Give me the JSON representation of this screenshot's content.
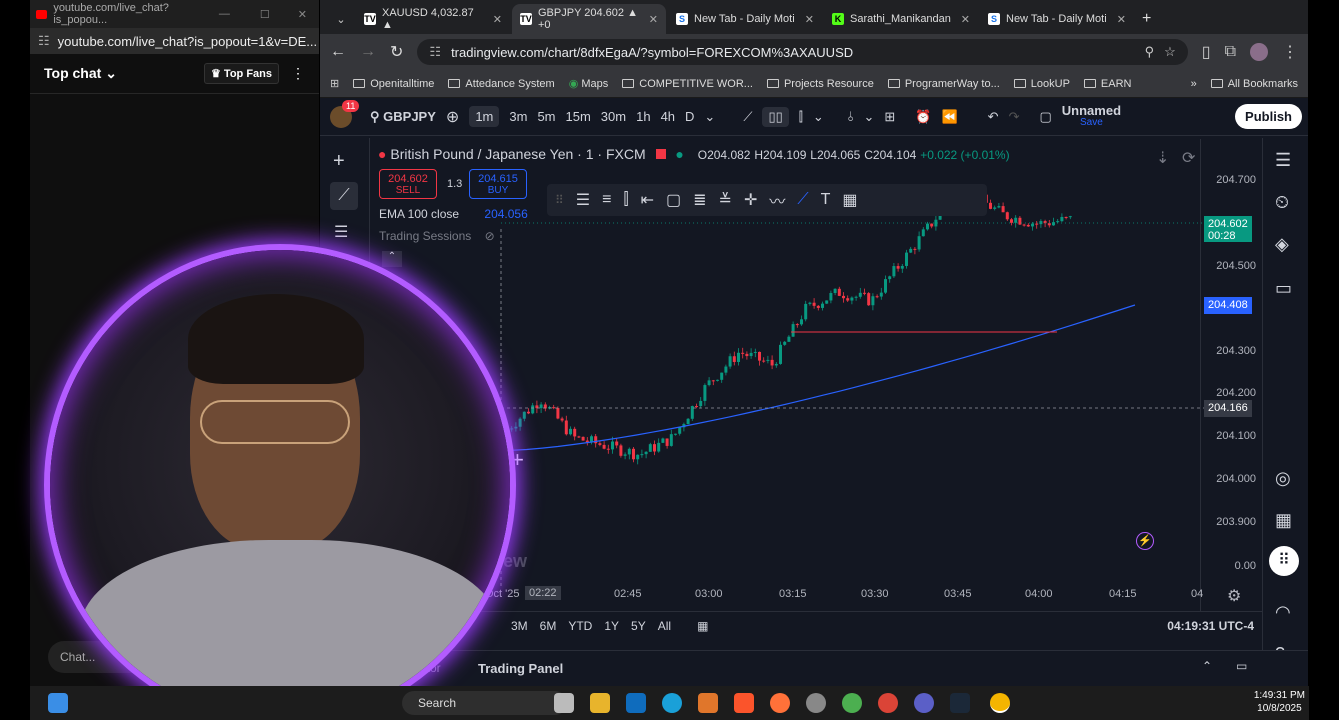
{
  "youtube": {
    "window_title": "youtube.com/live_chat?is_popou...",
    "url": "youtube.com/live_chat?is_popout=1&v=DE...",
    "top_chat": "Top chat",
    "top_fans": "Top Fans",
    "chat_placeholder": "Chat..."
  },
  "browser": {
    "tabs": [
      {
        "label": "XAUUSD 4,032.87 ▲",
        "active": false
      },
      {
        "label": "GBPJPY 204.602 ▲ +0",
        "active": true
      },
      {
        "label": "New Tab - Daily Moti",
        "active": false
      },
      {
        "label": "Sarathi_Manikandan",
        "active": false
      },
      {
        "label": "New Tab - Daily Moti",
        "active": false
      }
    ],
    "url": "tradingview.com/chart/8dfxEgaA/?symbol=FOREXCOM%3AXAUUSD",
    "bookmarks": [
      "Openitalltime",
      "Attedance System",
      "Maps",
      "COMPETITIVE WOR...",
      "Projects Resource",
      "ProgramerWay to...",
      "LookUP",
      "EARN"
    ],
    "all_bookmarks": "All Bookmarks"
  },
  "tv": {
    "notification_count": "11",
    "symbol": "GBPJPY",
    "intervals": [
      "1m",
      "3m",
      "5m",
      "15m",
      "30m",
      "1h",
      "4h",
      "D"
    ],
    "selected_interval": "1m",
    "layout_name": "Unnamed",
    "layout_status": "Save",
    "publish": "Publish",
    "legend_title": "British Pound / Japanese Yen · 1 · FXCM",
    "ohlc": {
      "o": "O204.082",
      "h": "H204.109",
      "l": "L204.065",
      "c": "C204.104",
      "chg": "+0.022 (+0.01%)"
    },
    "sell_price": "204.602",
    "sell_label": "SELL",
    "spread": "1.3",
    "buy_price": "204.615",
    "buy_label": "BUY",
    "ema_label": "EMA 100 close",
    "ema_value": "204.056",
    "sessions_label": "Trading Sessions",
    "price_label": "204.602",
    "countdown": "00:28",
    "ema_price_label": "204.408",
    "crosshair_price": "204.166",
    "watermark": "view",
    "y_ticks": [
      "204.700",
      "204.500",
      "204.300",
      "204.200",
      "204.100",
      "204.000",
      "203.900",
      "0.00"
    ],
    "x_ticks": [
      "Oct '25",
      "02:22",
      "02:45",
      "03:00",
      "03:15",
      "03:30",
      "03:45",
      "04:00",
      "04:15",
      "04"
    ],
    "ranges": [
      "3M",
      "6M",
      "YTD",
      "1Y",
      "5Y",
      "All"
    ],
    "time": "04:19:31 UTC-4",
    "panel_left": "itor",
    "panel_tab": "Trading Panel",
    "colors": {
      "up": "#089981",
      "down": "#f23645",
      "ema": "#2962ff",
      "bg": "#131722",
      "accent": "#2962ff"
    }
  },
  "taskbar": {
    "search": "Search",
    "time": "1:49:31 PM",
    "date": "10/8/2025"
  }
}
